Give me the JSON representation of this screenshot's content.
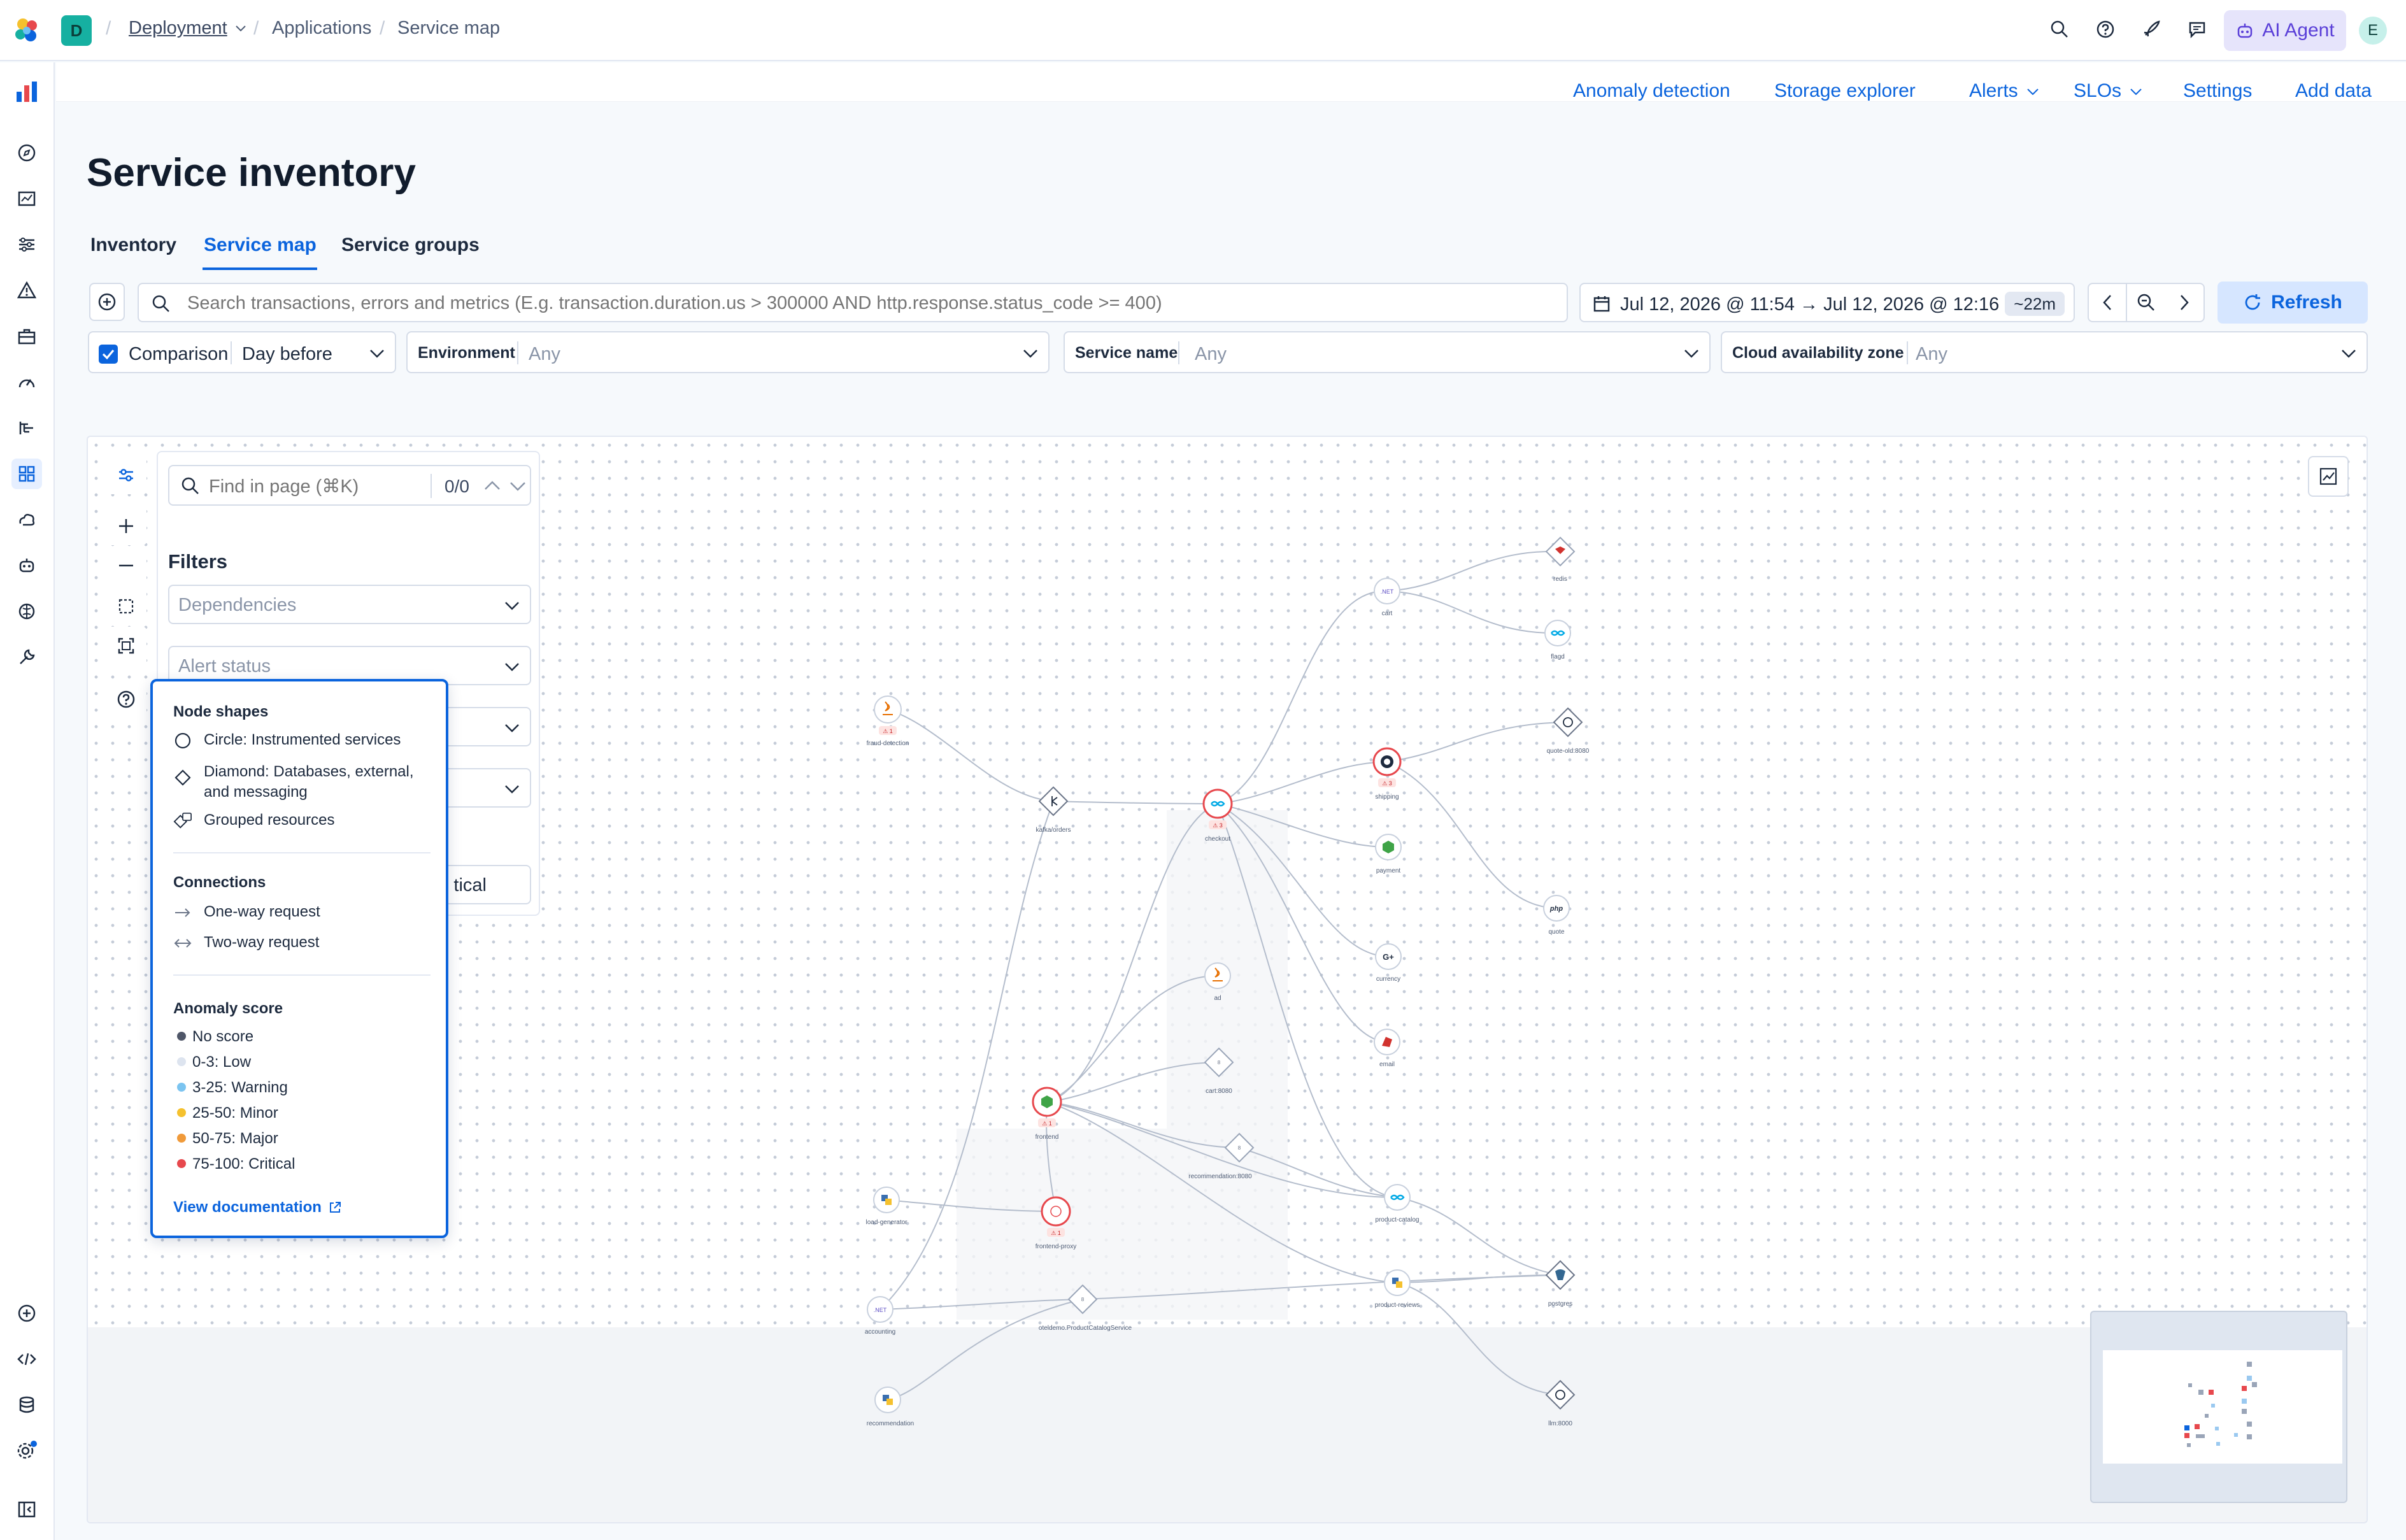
{
  "header": {
    "space_initial": "D",
    "breadcrumbs": [
      "Deployment",
      "Applications",
      "Service map"
    ],
    "ai_agent_label": "AI Agent",
    "user_initial": "E"
  },
  "subnav": {
    "links": [
      "Anomaly detection",
      "Storage explorer",
      "Alerts",
      "SLOs",
      "Settings",
      "Add data"
    ]
  },
  "page": {
    "title": "Service inventory",
    "tabs": [
      "Inventory",
      "Service map",
      "Service groups"
    ],
    "active_tab": "Service map"
  },
  "query": {
    "search_placeholder": "Search transactions, errors and metrics (E.g. transaction.duration.us > 300000 AND http.response.status_code >= 400)",
    "date_range": "Jul 12, 2026 @ 11:54 → Jul 12, 2026 @ 12:16",
    "date_badge": "~22m",
    "refresh_label": "Refresh"
  },
  "filters": {
    "comparison_label": "Comparison",
    "comparison_checked": true,
    "comparison_value": "Day before",
    "environment_label": "Environment",
    "environment_value": "Any",
    "service_name_label": "Service name",
    "service_name_value": "Any",
    "cloud_zone_label": "Cloud availability zone",
    "cloud_zone_value": "Any"
  },
  "find_panel": {
    "find_placeholder": "Find in page (⌘K)",
    "find_count": "0/0",
    "filters_title": "Filters",
    "dependencies_placeholder": "Dependencies",
    "alert_status_placeholder": "Alert status",
    "critical_partial": "tical"
  },
  "legend": {
    "node_shapes_title": "Node shapes",
    "node_shapes": [
      "Circle: Instrumented services",
      "Diamond: Databases, external,",
      "and messaging",
      "Grouped resources"
    ],
    "connections_title": "Connections",
    "connections": [
      "One-way request",
      "Two-way request"
    ],
    "anomaly_title": "Anomaly score",
    "anomaly_scores": [
      {
        "label": "No score",
        "color": "#4f5668"
      },
      {
        "label": "0-3: Low",
        "color": "#dde4ef"
      },
      {
        "label": "3-25: Warning",
        "color": "#7bc4f0"
      },
      {
        "label": "25-50: Minor",
        "color": "#f5c12e"
      },
      {
        "label": "50-75: Major",
        "color": "#f09a3a"
      },
      {
        "label": "75-100: Critical",
        "color": "#e7484d"
      }
    ],
    "docs_link": "View documentation"
  },
  "service_map": {
    "nodes": [
      {
        "id": "redis",
        "label": "redis"
      },
      {
        "id": "cart",
        "label": "cart",
        "icon_text": ".NET"
      },
      {
        "id": "flagd",
        "label": "flagd"
      },
      {
        "id": "fraud-detection",
        "label": "fraud-detection",
        "alerts": "1"
      },
      {
        "id": "kafka",
        "label": "kafka/orders"
      },
      {
        "id": "checkout",
        "label": "checkout",
        "alerts": "3"
      },
      {
        "id": "shipping",
        "label": "shipping",
        "alerts": "3"
      },
      {
        "id": "quote-old",
        "label": "quote-old:8080"
      },
      {
        "id": "payment",
        "label": "payment"
      },
      {
        "id": "quote",
        "label": "quote",
        "icon_text": "php"
      },
      {
        "id": "currency",
        "label": "currency"
      },
      {
        "id": "ad",
        "label": "ad"
      },
      {
        "id": "cart8080",
        "label": "cart:8080",
        "icon_text": "8"
      },
      {
        "id": "email",
        "label": "email"
      },
      {
        "id": "frontend",
        "label": "frontend",
        "alerts": "1"
      },
      {
        "id": "recommendation8080",
        "label": "recommendation:8080",
        "icon_text": "8"
      },
      {
        "id": "product-catalog",
        "label": "product-catalog"
      },
      {
        "id": "load-generator",
        "label": "load-generator"
      },
      {
        "id": "frontend-proxy",
        "label": "frontend-proxy",
        "alerts": "1"
      },
      {
        "id": "product-reviews",
        "label": "product-reviews"
      },
      {
        "id": "postgres",
        "label": "postgres"
      },
      {
        "id": "accounting",
        "label": "accounting",
        "icon_text": ".NET"
      },
      {
        "id": "otel-catalog",
        "label": "oteldemo.ProductCatalogService",
        "icon_text": "8"
      },
      {
        "id": "recommendation",
        "label": "recommendation"
      },
      {
        "id": "llm",
        "label": "llm:8000"
      }
    ]
  },
  "colors": {
    "brand_blue": "#0b64dd",
    "critical_red": "#e7484d",
    "edge": "#b4bdcc"
  }
}
